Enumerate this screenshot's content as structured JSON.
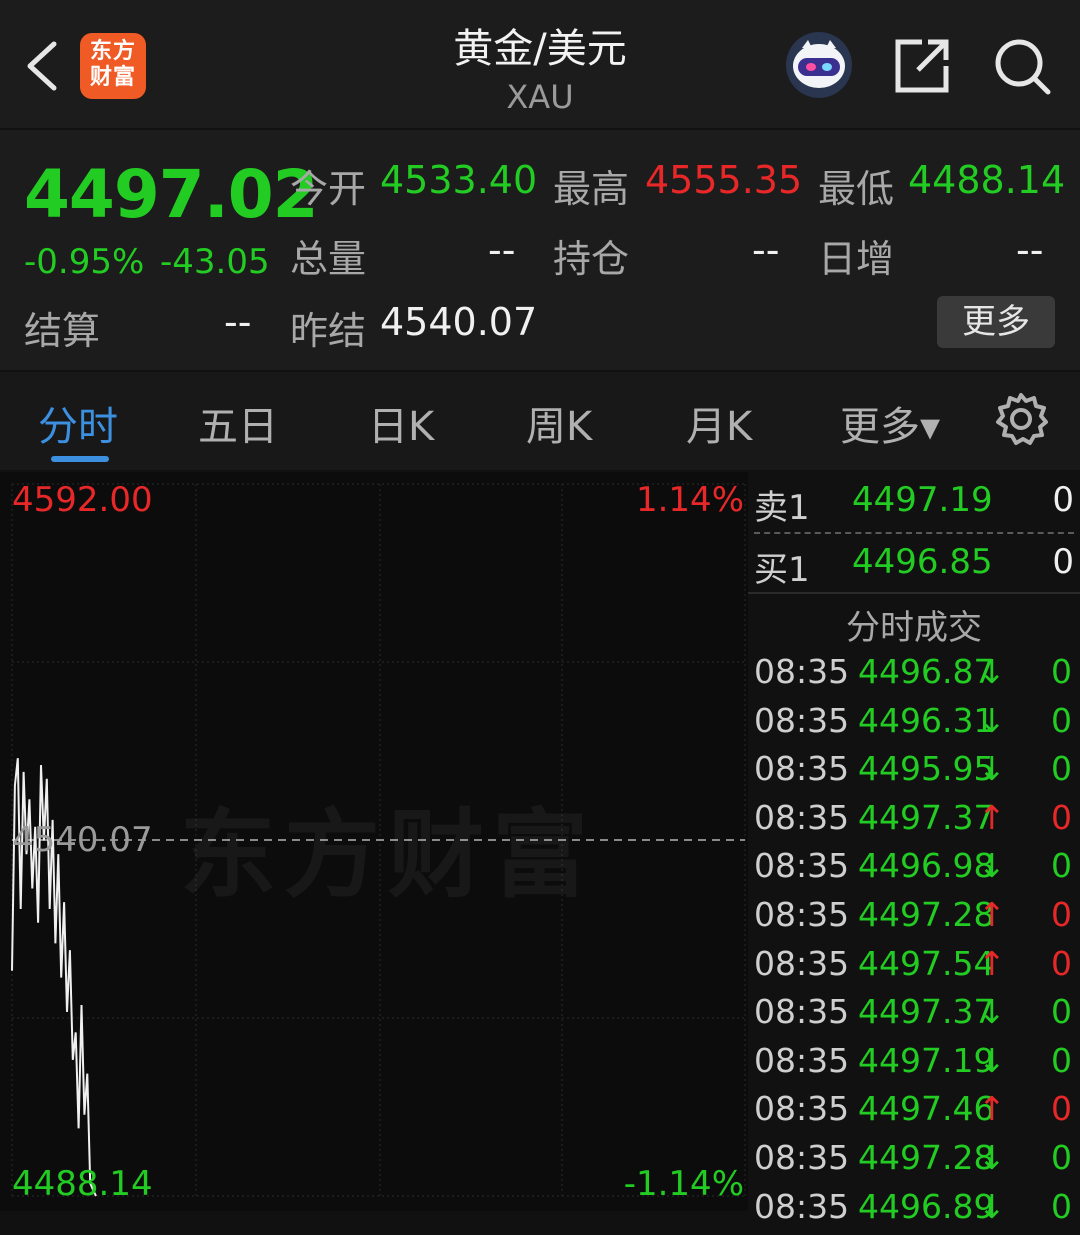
{
  "header": {
    "logo_text": "东方财富",
    "title": "黄金/美元",
    "subtitle": "XAU",
    "icons": [
      "back-icon",
      "robot-avatar-icon",
      "share-icon",
      "search-icon"
    ]
  },
  "quote": {
    "price": "4497.02",
    "change_pct": "-0.95%",
    "change": "-43.05",
    "open_label": "今开",
    "open": "4533.40",
    "high_label": "最高",
    "high": "4555.35",
    "low_label": "最低",
    "low": "4488.14",
    "volume_label": "总量",
    "volume": "--",
    "oi_label": "持仓",
    "oi": "--",
    "daily_inc_label": "日增",
    "daily_inc": "--",
    "settle_label": "结算",
    "settle": "--",
    "prev_settle_label": "昨结",
    "prev_settle": "4540.07",
    "more_label": "更多"
  },
  "tabs": [
    "分时",
    "五日",
    "日K",
    "周K",
    "月K",
    "更多▾"
  ],
  "chart": {
    "watermark": "东方财富",
    "top_price": "4592.00",
    "top_pct": "1.14%",
    "mid_price": "4540.07",
    "bottom_price": "4488.14",
    "bottom_pct": "-1.14%"
  },
  "chart_data": {
    "type": "line",
    "title": "",
    "xlabel": "",
    "ylabel": "",
    "ylim": [
      4488.14,
      4592.0
    ],
    "reference_line": 4540.07,
    "series": [
      {
        "values": [
          4521,
          4548,
          4552,
          4530,
          4550,
          4538,
          4546,
          4533,
          4542,
          4528,
          4551,
          4540,
          4549,
          4530,
          4543,
          4525,
          4538,
          4520,
          4531,
          4515,
          4524,
          4508,
          4512,
          4498,
          4516,
          4500,
          4506,
          4490,
          4489,
          4488.14
        ]
      }
    ]
  },
  "orderbook": {
    "ask_label": "卖1",
    "ask_price": "4497.19",
    "ask_vol": "0",
    "bid_label": "买1",
    "bid_price": "4496.85",
    "bid_vol": "0"
  },
  "ticks_title": "分时成交",
  "ticks": [
    {
      "time": "08:35",
      "price": "4496.87",
      "dir": "↓",
      "vol": "0",
      "up": false
    },
    {
      "time": "08:35",
      "price": "4496.31",
      "dir": "↓",
      "vol": "0",
      "up": false
    },
    {
      "time": "08:35",
      "price": "4495.95",
      "dir": "↓",
      "vol": "0",
      "up": false
    },
    {
      "time": "08:35",
      "price": "4497.37",
      "dir": "↑",
      "vol": "0",
      "up": true
    },
    {
      "time": "08:35",
      "price": "4496.98",
      "dir": "↓",
      "vol": "0",
      "up": false
    },
    {
      "time": "08:35",
      "price": "4497.28",
      "dir": "↑",
      "vol": "0",
      "up": true
    },
    {
      "time": "08:35",
      "price": "4497.54",
      "dir": "↑",
      "vol": "0",
      "up": true
    },
    {
      "time": "08:35",
      "price": "4497.37",
      "dir": "↓",
      "vol": "0",
      "up": false
    },
    {
      "time": "08:35",
      "price": "4497.19",
      "dir": "↓",
      "vol": "0",
      "up": false
    },
    {
      "time": "08:35",
      "price": "4497.46",
      "dir": "↑",
      "vol": "0",
      "up": true
    },
    {
      "time": "08:35",
      "price": "4497.28",
      "dir": "↓",
      "vol": "0",
      "up": false
    },
    {
      "time": "08:35",
      "price": "4496.89",
      "dir": "↓",
      "vol": "0",
      "up": false
    }
  ],
  "colors": {
    "up": "#e82828",
    "down": "#22cc22",
    "accent": "#3d8fe0",
    "logo": "#f05a24"
  }
}
